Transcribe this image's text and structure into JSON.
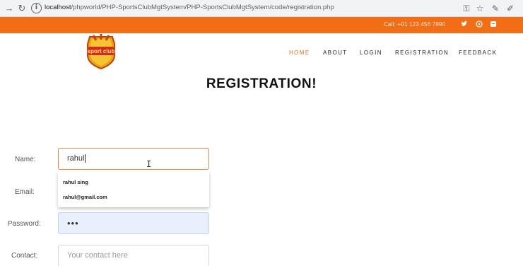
{
  "browser": {
    "url_host": "localhost",
    "url_path": "/phpworld/PHP-SportsClubMgtSystem/PHP-SportsClubMgtSystem/code/registration.php"
  },
  "topbar": {
    "call_text": "Call: +01 123 456 7890",
    "social": [
      "twitter-icon",
      "pinterest-icon",
      "instagram-icon"
    ],
    "color": "#f26e16"
  },
  "logo": {
    "text": "sport club"
  },
  "nav": {
    "items": [
      {
        "label": "HOME",
        "active": true
      },
      {
        "label": "ABOUT"
      },
      {
        "label": "LOGIN"
      },
      {
        "label": "REGISTRATION"
      },
      {
        "label": "FEEDBACK"
      }
    ],
    "accent": "#e46b1c"
  },
  "page": {
    "title": "REGISTRATION!"
  },
  "form": {
    "name": {
      "label": "Name:",
      "value": "rahul"
    },
    "email": {
      "label": "Email:"
    },
    "password": {
      "label": "Password:",
      "value": "•••"
    },
    "contact": {
      "label": "Contact:",
      "placeholder": "Your contact here"
    }
  },
  "autocomplete": {
    "options": [
      "rahul sing",
      "rahul@gmail.com"
    ]
  }
}
